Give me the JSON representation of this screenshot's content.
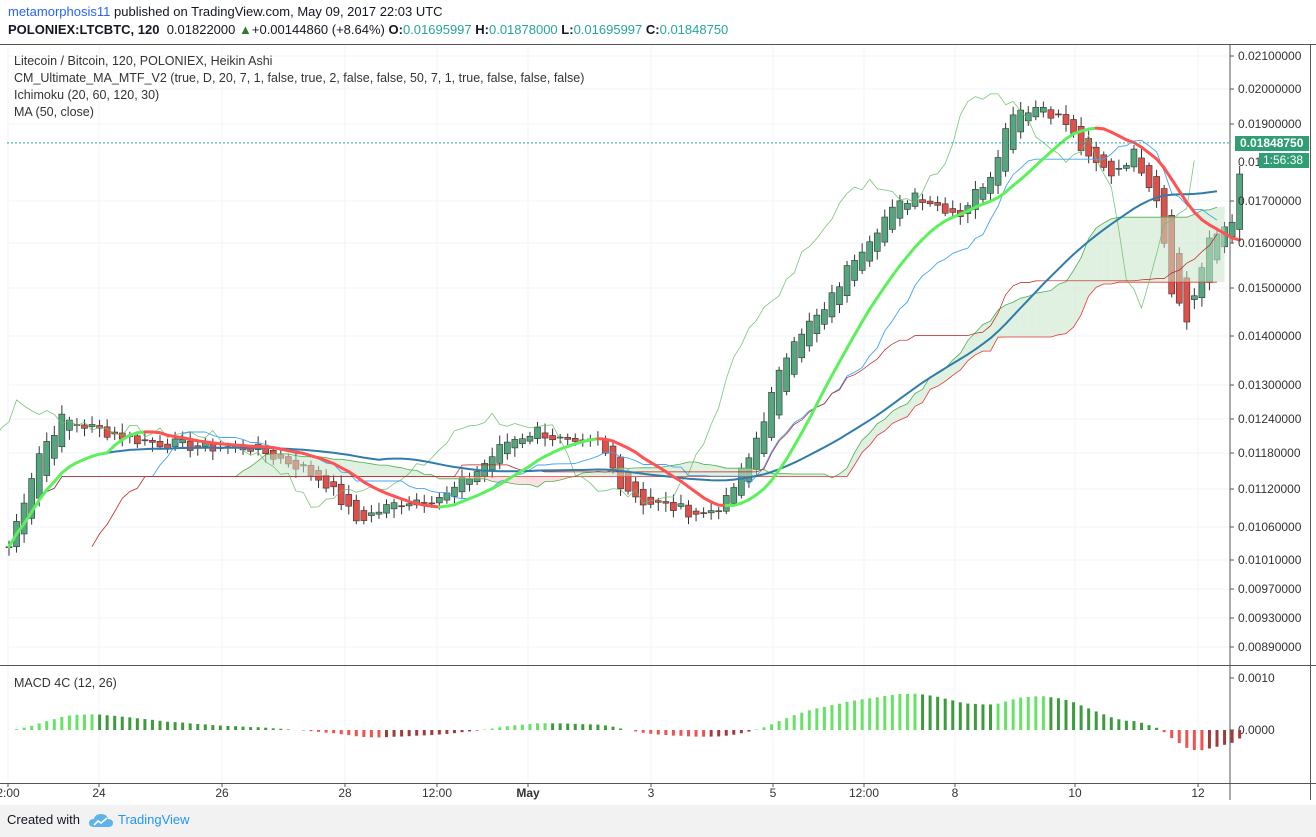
{
  "header": {
    "author": "metamorphosis11",
    "published_text": "published on TradingView.com, May 09, 2017 22:03 UTC",
    "symbol": "POLONIEX:LTCBTC, 120",
    "last": "0.01822000",
    "change": "+0.00144860 (+8.64%)",
    "o_label": "O:",
    "o_value": "0.01695997",
    "h_label": "H:",
    "h_value": "0.01878000",
    "l_label": "L:",
    "l_value": "0.01695997",
    "c_label": "C:",
    "c_value": "0.01848750"
  },
  "legend": {
    "title": "Litecoin / Bitcoin, 120, POLONIEX, Heikin Ashi",
    "ind1": "CM_Ultimate_MA_MTF_V2 (true, D, 20, 7, 1, false, true, 2, false, false, 50, 7, 1, true, false, false, false)",
    "ind2": "Ichimoku (20, 60, 120, 30)",
    "ind3": "MA (50, close)",
    "macd": "MACD 4C (12, 26)"
  },
  "badges": {
    "price": "0.01848750",
    "countdown": "1:56:38",
    "price_partial": "0.01"
  },
  "footer": {
    "created": "Created with",
    "brand": "TradingView"
  },
  "colors": {
    "up": "#53a67e",
    "down": "#e0504a",
    "ma_green": "#5cf15c",
    "ma_red": "#ff5252",
    "ma50": "#2f7cab",
    "cloud_bull": "#c8e6c9",
    "cloud_bear": "#f7c8c8"
  },
  "chart_data": [
    {
      "type": "candlestick",
      "style": "Heikin Ashi",
      "yscale": "log",
      "ylim": [
        0.0087,
        0.0212
      ],
      "y_ticks": [
        "0.02100000",
        "0.02000000",
        "0.01900000",
        "0.01700000",
        "0.01600000",
        "0.01500000",
        "0.01400000",
        "0.01300000",
        "0.01240000",
        "0.01180000",
        "0.01120000",
        "0.01060000",
        "0.01010000",
        "0.00970000",
        "0.00930000",
        "0.00890000"
      ],
      "x_ticks": [
        "2:00",
        "24",
        "26",
        "28",
        "12:00",
        "May",
        "3",
        "5",
        "12:00",
        "8",
        "10",
        "12"
      ],
      "last_price": 0.0184875,
      "grid": true
    },
    {
      "type": "bar",
      "name": "MACD 4C (12, 26)",
      "y_ticks": [
        "0.0010",
        "0.0000"
      ],
      "ylim": [
        -0.0009,
        0.0011
      ]
    }
  ]
}
